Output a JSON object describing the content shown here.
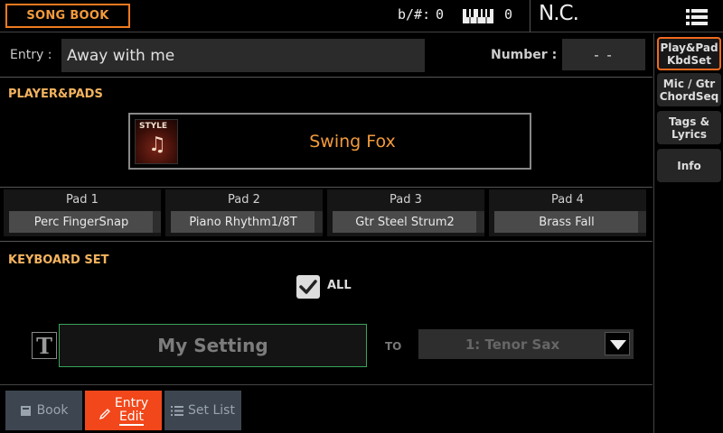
{
  "header": {
    "title": "SONG BOOK",
    "transpose_label": "b/#:",
    "transpose_value": "0",
    "keyboard_value": "0",
    "chord": "N.C."
  },
  "entry": {
    "label": "Entry :",
    "value": "Away with me",
    "number_label": "Number :",
    "number_value": "- -"
  },
  "player_pads": {
    "section_title": "PLAYER&PADS",
    "style_tag": "STYLE",
    "style_name": "Swing Fox",
    "pads": [
      {
        "title": "Pad 1",
        "value": "Perc FingerSnap"
      },
      {
        "title": "Pad 2",
        "value": "Piano Rhythm1/8T"
      },
      {
        "title": "Pad 3",
        "value": "Gtr Steel Strum2"
      },
      {
        "title": "Pad 4",
        "value": "Brass Fall"
      }
    ]
  },
  "keyboard_set": {
    "section_title": "KEYBOARD SET",
    "all_label": "ALL",
    "all_checked": true,
    "setting_name": "My Setting",
    "to_label": "TO",
    "sound_value": "1: Tenor Sax"
  },
  "sidebar": {
    "tabs": [
      {
        "line1": "Play&Pad",
        "line2": "KbdSet",
        "active": true
      },
      {
        "line1": "Mic / Gtr",
        "line2": "ChordSeq",
        "active": false
      },
      {
        "line1": "Tags &",
        "line2": "Lyrics",
        "active": false
      },
      {
        "line1": "Info",
        "line2": "",
        "active": false
      }
    ]
  },
  "bottom_tabs": [
    {
      "label": "Book",
      "icon": "book-icon",
      "active": false
    },
    {
      "label_line1": "Entry",
      "label_line2": "Edit",
      "icon": "pencil-icon",
      "active": true
    },
    {
      "label": "Set List",
      "icon": "list-icon",
      "active": false
    }
  ],
  "colors": {
    "accent": "#f39a3c",
    "active_tab": "#f2471a",
    "section_title": "#f3b35e",
    "setting_border": "#3aa35a"
  }
}
